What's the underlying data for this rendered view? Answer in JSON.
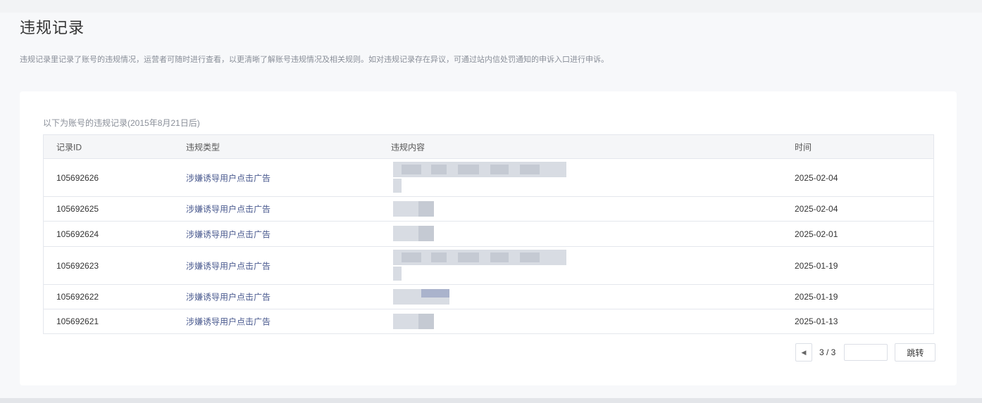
{
  "page": {
    "title": "违规记录",
    "description": "违规记录里记录了账号的违规情况，运营者可随时进行查看，以更清晰了解账号违规情况及相关规则。如对违规记录存在异议，可通过站内信处罚通知的申诉入口进行申诉。"
  },
  "records": {
    "subtitle": "以下为账号的违规记录(2015年8月21日后)",
    "columns": [
      "记录ID",
      "违规类型",
      "违规内容",
      "时间"
    ],
    "rows": [
      {
        "id": "105692626",
        "type": "涉嫌诱导用户点击广告",
        "time": "2025-02-04"
      },
      {
        "id": "105692625",
        "type": "涉嫌诱导用户点击广告",
        "time": "2025-02-04"
      },
      {
        "id": "105692624",
        "type": "涉嫌诱导用户点击广告",
        "time": "2025-02-01"
      },
      {
        "id": "105692623",
        "type": "涉嫌诱导用户点击广告",
        "time": "2025-01-19"
      },
      {
        "id": "105692622",
        "type": "涉嫌诱导用户点击广告",
        "time": "2025-01-19"
      },
      {
        "id": "105692621",
        "type": "涉嫌诱导用户点击广告",
        "time": "2025-01-13"
      }
    ]
  },
  "pagination": {
    "prev_icon": "caret-left-icon",
    "page_info": "3 / 3",
    "input_value": "",
    "jump_label": "跳转"
  }
}
